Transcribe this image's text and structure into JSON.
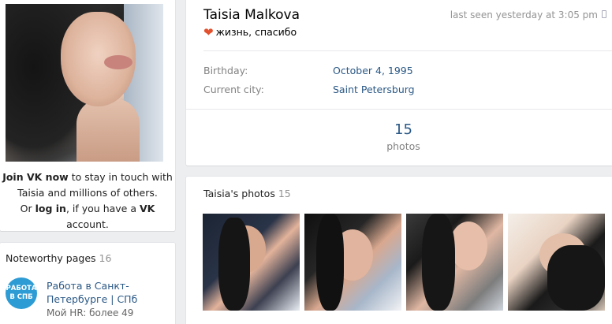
{
  "profile": {
    "name": "Taisia Malkova",
    "last_seen": "last seen yesterday at 3:05 pm",
    "status_text": "жизнь, спасибо",
    "info": [
      {
        "label": "Birthday:",
        "value": "October 4, 1995"
      },
      {
        "label": "Current city:",
        "value": "Saint Petersburg"
      }
    ],
    "counter": {
      "number": "15",
      "label": "photos"
    }
  },
  "join": {
    "line1_bold": "Join VK now",
    "line1_rest": " to stay in touch with",
    "line2": "Taisia and millions of others.",
    "line3_pre": "Or ",
    "line3_login": "log in",
    "line3_mid": ", if you have a ",
    "line3_vk": "VK",
    "line3_post": " account."
  },
  "noteworthy": {
    "title": "Noteworthy pages",
    "count": "16",
    "page": {
      "logo_text_1": "РАБОТА",
      "logo_text_2": "В СПБ",
      "name": "Работа в Санкт-Петербурге | СПб",
      "sub": "Мой HR: более 49"
    }
  },
  "photos": {
    "title": "Taisia's photos",
    "count": "15"
  },
  "colors": {
    "link": "#2a5885",
    "muted": "#828282",
    "background": "#edeef0",
    "heart": "#e2502d"
  },
  "icons": {
    "status": "heart-icon",
    "mobile": "phone-icon"
  }
}
